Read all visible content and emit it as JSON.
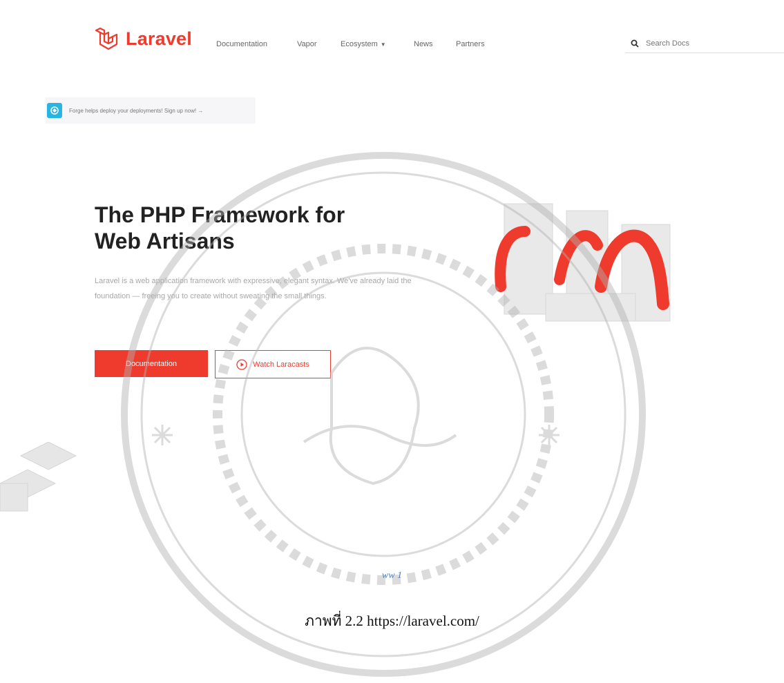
{
  "nav": {
    "brand": "Laravel",
    "links": [
      "Documentation",
      "Vapor",
      "Ecosystem",
      "News",
      "Partners"
    ],
    "search_placeholder": "Search Docs",
    "colors": {
      "brand": "#ef3b2d"
    }
  },
  "banner": {
    "text": "Forge helps deploy your deployments! Sign up now! →",
    "icon": "forge-icon"
  },
  "hero": {
    "title_line1": "The PHP Framework for",
    "title_line2": "Web Artisans",
    "description": "Laravel is a web application framework with expressive, elegant syntax. We've already laid the foundation — freeing you to create without sweating the small things.",
    "primary_button": "Documentation",
    "secondary_button": "Watch Laracasts"
  },
  "captions": {
    "small": "ww 1",
    "main": "ภาพที่ 2.2 https://laravel.com/"
  }
}
